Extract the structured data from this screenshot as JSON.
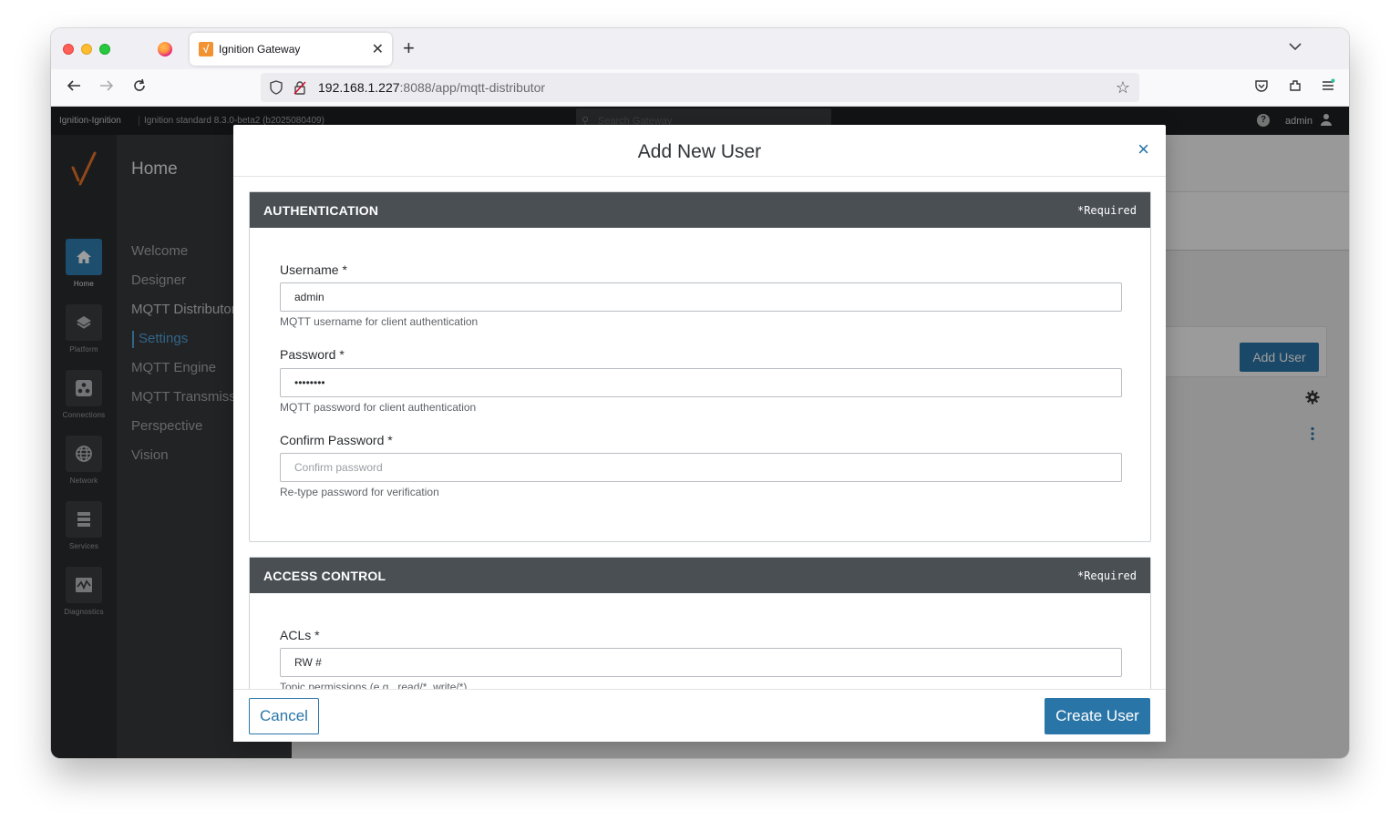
{
  "browser": {
    "tab_title": "Ignition Gateway",
    "tab_favicon_glyph": "√",
    "url_host": "192.168.1.227",
    "url_rest": ":8088/app/mqtt-distributor"
  },
  "app_header": {
    "gateway_name": "Ignition-Ignition",
    "gateway_version": "Ignition standard 8.3.0-beta2 (b2025080409)",
    "search_placeholder": "Search Gateway",
    "user": "admin"
  },
  "rail": {
    "items": [
      {
        "label": "Home",
        "icon": "home-icon",
        "active": true
      },
      {
        "label": "Platform",
        "icon": "layers-icon"
      },
      {
        "label": "Connections",
        "icon": "connections-icon"
      },
      {
        "label": "Network",
        "icon": "globe-icon"
      },
      {
        "label": "Services",
        "icon": "server-icon"
      },
      {
        "label": "Diagnostics",
        "icon": "pulse-icon"
      }
    ]
  },
  "nav": {
    "title": "Home",
    "items": [
      {
        "label": "Welcome"
      },
      {
        "label": "Designer"
      },
      {
        "label": "MQTT Distributor"
      },
      {
        "label": "Settings",
        "selected": true
      },
      {
        "label": "MQTT Engine"
      },
      {
        "label": "MQTT Transmission"
      },
      {
        "label": "Perspective"
      },
      {
        "label": "Vision"
      }
    ]
  },
  "main": {
    "add_user_label": "Add User"
  },
  "modal": {
    "title": "Add New User",
    "close_glyph": "×",
    "sections": [
      {
        "title": "AUTHENTICATION",
        "required": "*Required",
        "fields": [
          {
            "label": "Username *",
            "value": "admin",
            "placeholder": "",
            "help": "MQTT username for client authentication"
          },
          {
            "label": "Password *",
            "value": "••••••••",
            "placeholder": "",
            "help": "MQTT password for client authentication"
          },
          {
            "label": "Confirm Password *",
            "value": "",
            "placeholder": "Confirm password",
            "help": "Re-type password for verification"
          }
        ]
      },
      {
        "title": "ACCESS CONTROL",
        "required": "*Required",
        "fields": [
          {
            "label": "ACLs *",
            "value": "RW #",
            "placeholder": "",
            "help": "Topic permissions (e.g., read/*, write/*)"
          }
        ]
      }
    ],
    "cancel_label": "Cancel",
    "create_label": "Create User"
  },
  "colors": {
    "accent": "#2a75a8",
    "section_header": "#4a4f54",
    "nav_selected": "#4fa3dc"
  }
}
